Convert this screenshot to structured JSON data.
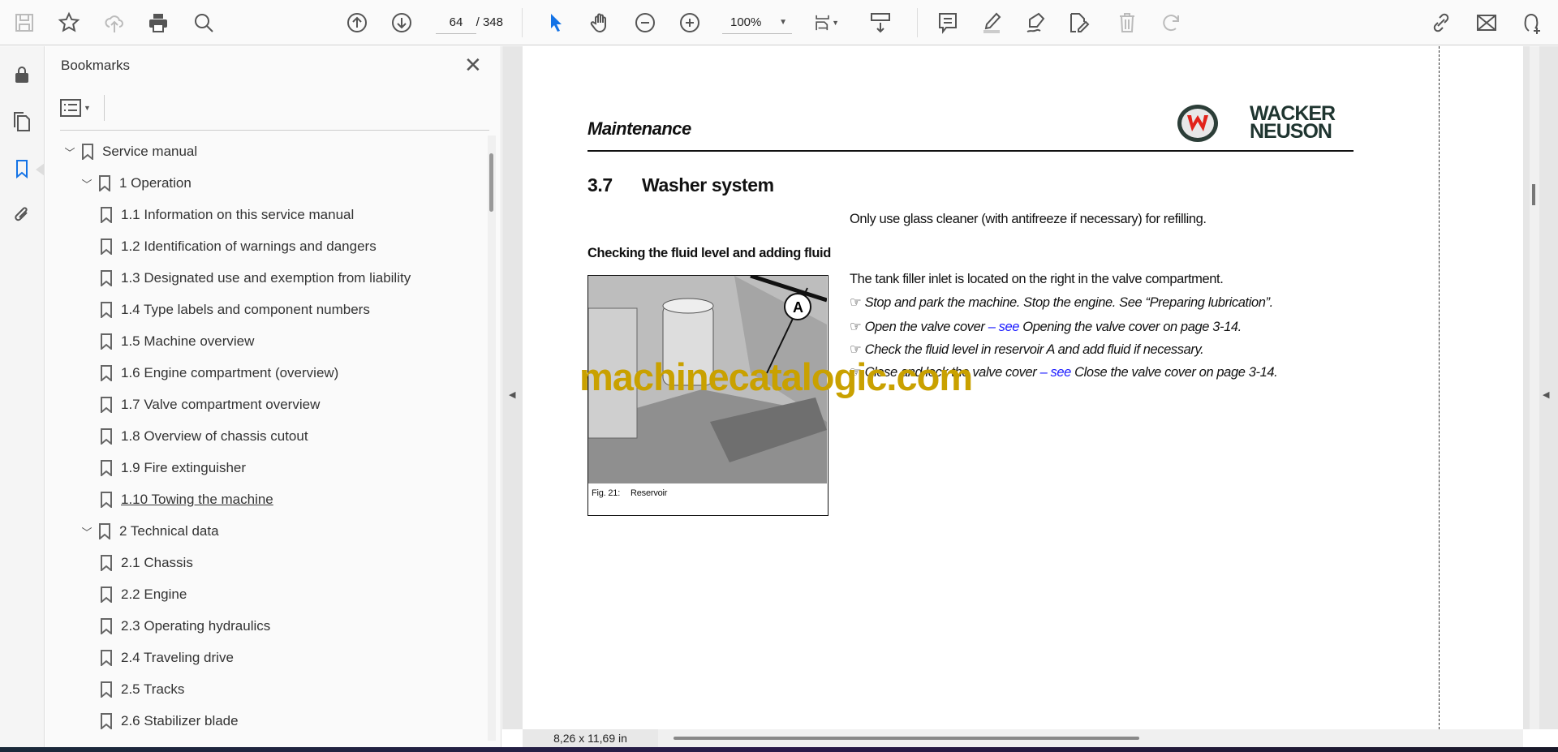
{
  "toolbar": {
    "page_current": "64",
    "page_total": "/ 348",
    "zoom": "100%",
    "icons": [
      "save-icon",
      "star-icon",
      "cloud-upload-icon",
      "print-icon",
      "search-icon",
      "page-up-icon",
      "page-down-icon",
      "select-cursor-icon",
      "hand-icon",
      "zoom-out-icon",
      "zoom-in-icon",
      "fit-page-icon",
      "scroll-mode-icon",
      "comment-icon",
      "highlight-icon",
      "sign-icon",
      "edit-pdf-icon",
      "delete-icon",
      "rotate-icon",
      "share-link-icon",
      "email-icon",
      "add-user-icon"
    ]
  },
  "rail": {
    "icons": [
      "lock-icon",
      "pages-icon",
      "bookmark-icon",
      "attachment-icon"
    ],
    "active": "bookmark-icon",
    "accent": "#1473e6"
  },
  "bookmarks": {
    "title": "Bookmarks",
    "items": [
      {
        "label": "Service manual",
        "level": 0,
        "expanded": true
      },
      {
        "label": "1 Operation",
        "level": 1,
        "expanded": true
      },
      {
        "label": "1.1 Information on this service manual",
        "level": 2
      },
      {
        "label": "1.2 Identification of warnings and dangers",
        "level": 2
      },
      {
        "label": "1.3 Designated use and exemption from liability",
        "level": 2
      },
      {
        "label": "1.4 Type labels and component numbers",
        "level": 2
      },
      {
        "label": "1.5 Machine overview",
        "level": 2
      },
      {
        "label": "1.6 Engine compartment (overview)",
        "level": 2
      },
      {
        "label": "1.7 Valve compartment overview",
        "level": 2
      },
      {
        "label": "1.8 Overview of chassis cutout",
        "level": 2
      },
      {
        "label": "1.9 Fire extinguisher",
        "level": 2
      },
      {
        "label": "1.10 Towing the machine",
        "level": 2,
        "underlined": true
      },
      {
        "label": "2 Technical data",
        "level": 1,
        "expanded": true
      },
      {
        "label": "2.1 Chassis",
        "level": 2
      },
      {
        "label": "2.2 Engine",
        "level": 2
      },
      {
        "label": "2.3 Operating hydraulics",
        "level": 2
      },
      {
        "label": "2.4 Traveling drive",
        "level": 2
      },
      {
        "label": "2.5 Tracks",
        "level": 2
      },
      {
        "label": "2.6 Stabilizer blade",
        "level": 2
      }
    ]
  },
  "page": {
    "header": "Maintenance",
    "logo": "WACKER NEUSON",
    "section_number": "3.7",
    "section_title": "Washer system",
    "note": "Only use glass cleaner (with antifreeze if necessary) for refilling.",
    "subheading": "Checking the fluid level and adding fluid",
    "intro": "The tank filler inlet is located on the right in the valve compartment.",
    "steps": [
      {
        "text": "Stop and park the machine. Stop the engine. See “Preparing lubrication”."
      },
      {
        "text": "Open the valve cover",
        "link": "– see",
        "ref": "Opening the valve cover on page 3-14."
      },
      {
        "text": "Check the fluid level in reservoir A and add fluid if necessary."
      },
      {
        "text": "Close and lock the valve cover",
        "link": "– see",
        "ref": "Close the valve cover on page 3-14."
      }
    ],
    "bullet": "☞",
    "figure_label": "A",
    "figure_caption_num": "Fig. 21:",
    "figure_caption": "Reservoir",
    "watermark": "machinecatalogic.com",
    "watermark_color": "#c9a100"
  },
  "status": {
    "page_size": "8,26 x 11,69 in"
  }
}
